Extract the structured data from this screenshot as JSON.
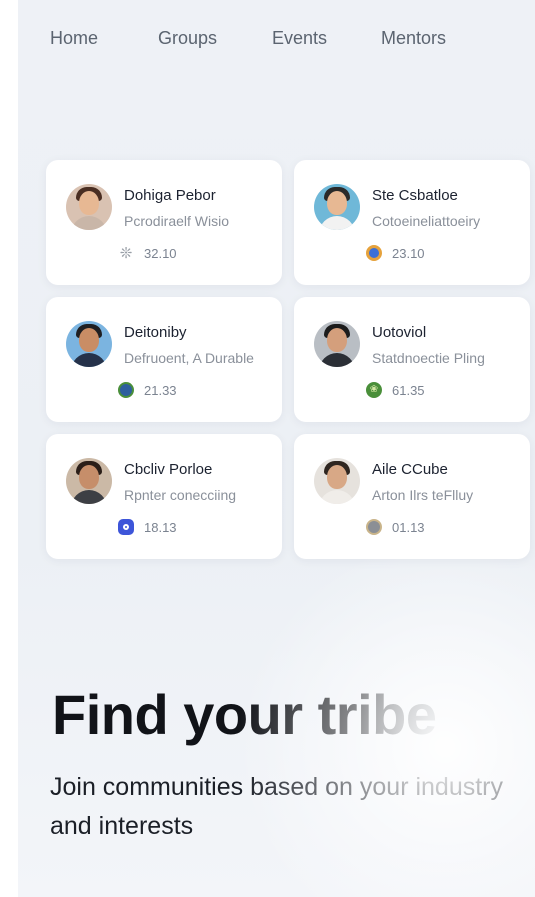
{
  "nav": {
    "items": [
      "Home",
      "Groups",
      "Events",
      "Mentors"
    ]
  },
  "mentors": [
    {
      "name": "Dohiga Pebor",
      "role": "Pcrodiraelf Wisio",
      "count": "32.10",
      "badge_icon": "sparkle-icon",
      "badge_color": "#9aa0a8"
    },
    {
      "name": "Ste Csbatloe",
      "role": "Cotoeineliattoeiry",
      "count": "23.10",
      "badge_icon": "globe-icon",
      "badge_color": "#3b6fd6"
    },
    {
      "name": "Deitoniby",
      "role": "Defruoent, A Durable",
      "count": "21.33",
      "badge_icon": "globe-icon",
      "badge_color": "#2e5f9e"
    },
    {
      "name": "Uotoviol",
      "role": "Statdnoectie Pling",
      "count": "61.35",
      "badge_icon": "leaf-icon",
      "badge_color": "#4a8f3a"
    },
    {
      "name": "Cbcliv Porloe",
      "role": "Rpnter conecciing",
      "count": "18.13",
      "badge_icon": "app-icon",
      "badge_color": "#3d55d9"
    },
    {
      "name": "Aile CCube",
      "role": "Arton Ilrs teFlluy",
      "count": "01.13",
      "badge_icon": "photo-icon",
      "badge_color": "#8b8f95"
    }
  ],
  "hero": {
    "title": "Find your tribe",
    "subtitle": "Join communities based on your industry and interests"
  },
  "colors": {
    "background": "#eef1f6",
    "card": "#ffffff",
    "title_text": "#111318"
  }
}
